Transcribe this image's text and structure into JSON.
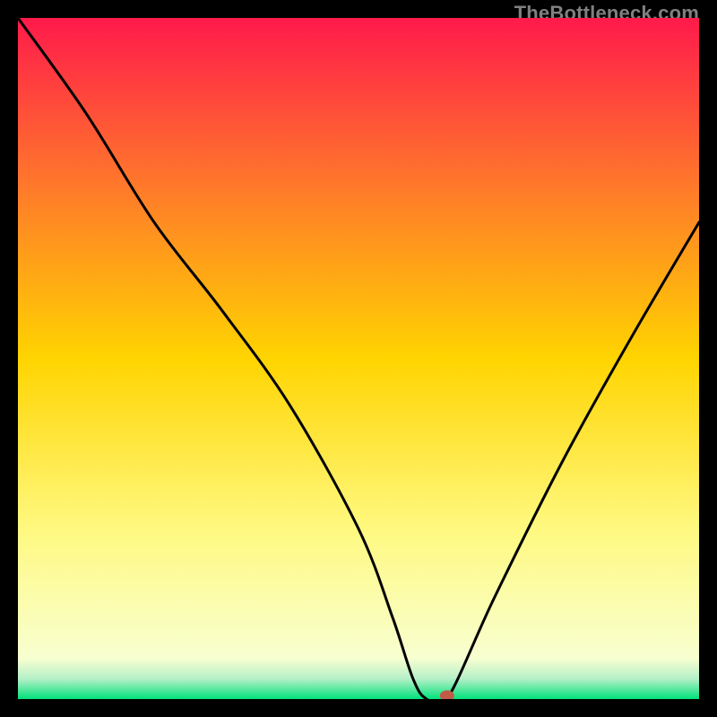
{
  "watermark": "TheBottleneck.com",
  "chart_data": {
    "type": "line",
    "title": "",
    "xlabel": "",
    "ylabel": "",
    "xlim": [
      0,
      100
    ],
    "ylim": [
      0,
      100
    ],
    "grid": false,
    "legend": false,
    "series": [
      {
        "name": "curve",
        "x": [
          0,
          10,
          20,
          30,
          40,
          50,
          55,
          58,
          60,
          63,
          70,
          80,
          90,
          100
        ],
        "values": [
          100,
          86,
          70,
          57,
          43,
          25,
          12,
          3,
          0,
          0,
          15,
          35,
          53,
          70
        ]
      }
    ],
    "marker": {
      "x": 63,
      "y": 0.5,
      "color": "#c15a49"
    },
    "gradient_stops": [
      {
        "offset": 0.0,
        "color": "#ff1a4b"
      },
      {
        "offset": 0.25,
        "color": "#ff7a2a"
      },
      {
        "offset": 0.5,
        "color": "#ffd400"
      },
      {
        "offset": 0.75,
        "color": "#fff980"
      },
      {
        "offset": 0.94,
        "color": "#f8ffd0"
      },
      {
        "offset": 0.97,
        "color": "#b6f0c8"
      },
      {
        "offset": 1.0,
        "color": "#00e27a"
      }
    ]
  }
}
